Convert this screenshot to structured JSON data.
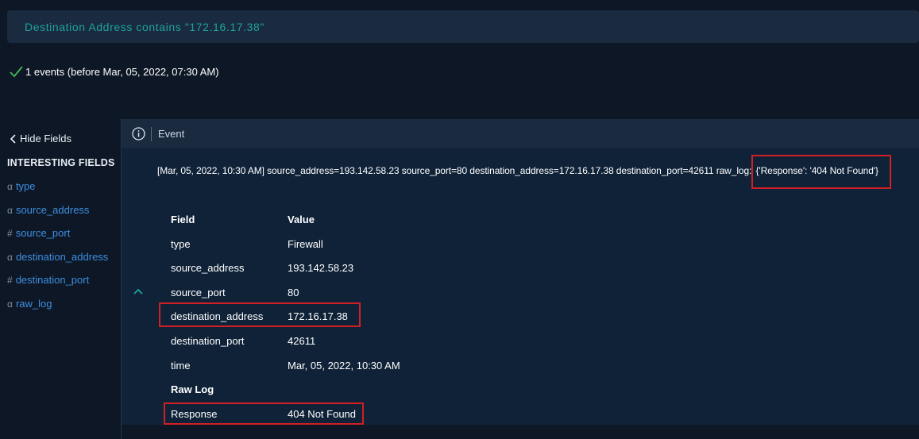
{
  "query": {
    "text": "Destination Address contains \"172.16.17.38\""
  },
  "status": {
    "text": "1 events (before Mar, 05, 2022, 07:30 AM)"
  },
  "sidebar": {
    "hide_fields_label": "Hide Fields",
    "interesting_title": "INTERESTING FIELDS",
    "fields": [
      {
        "symbol": "α",
        "name": "type"
      },
      {
        "symbol": "α",
        "name": "source_address"
      },
      {
        "symbol": "#",
        "name": "source_port"
      },
      {
        "symbol": "α",
        "name": "destination_address"
      },
      {
        "symbol": "#",
        "name": "destination_port"
      },
      {
        "symbol": "α",
        "name": "raw_log"
      }
    ]
  },
  "event": {
    "header_label": "Event",
    "raw_prefix": "[Mar, 05, 2022, 10:30 AM] source_address=193.142.58.23 source_port=80 destination_address=172.16.17.38 destination_port=42611 raw_log:",
    "raw_response": "{'Response': '404 Not Found'}",
    "table_head": {
      "field": "Field",
      "value": "Value"
    },
    "rows": [
      {
        "field": "type",
        "value": "Firewall"
      },
      {
        "field": "source_address",
        "value": "193.142.58.23"
      },
      {
        "field": "source_port",
        "value": "80"
      },
      {
        "field": "destination_address",
        "value": "172.16.17.38"
      },
      {
        "field": "destination_port",
        "value": "42611"
      },
      {
        "field": "time",
        "value": "Mar, 05, 2022, 10:30 AM"
      }
    ],
    "raw_log_label": "Raw Log",
    "response_row": {
      "field": "Response",
      "value": "404 Not Found"
    }
  },
  "colors": {
    "background": "#0e1726",
    "panel": "#1a2a3f",
    "accent_teal": "#1fa39a",
    "link_blue": "#3c8fe0",
    "highlight_red": "#d21f25",
    "success_green": "#3fb950"
  }
}
